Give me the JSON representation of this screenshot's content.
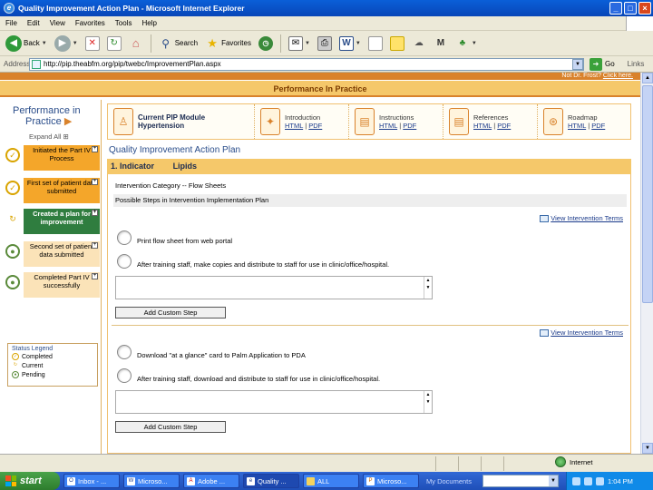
{
  "window": {
    "title": "Quality Improvement Action Plan - Microsoft Internet Explorer",
    "buttons": [
      "_",
      "□",
      "×"
    ]
  },
  "menu": [
    "File",
    "Edit",
    "View",
    "Favorites",
    "Tools",
    "Help"
  ],
  "toolbar": {
    "back_label": "Back",
    "search_label": "Search",
    "favorites_label": "Favorites"
  },
  "address": {
    "label": "Address",
    "url": "http://pip.theabfm.org/pip/twebc/ImprovementPlan.aspx",
    "go_label": "Go",
    "links_label": "Links"
  },
  "site": {
    "top_link_prefix": "Not Dr. Frost?",
    "top_link": "Click here.",
    "banner": "Performance In Practice",
    "logo_line1": "Performance in",
    "logo_line2": "Practice",
    "expand_all": "Expand All",
    "legend_title": "Status Legend",
    "legend": [
      "Completed",
      "Current",
      "Pending"
    ]
  },
  "steps": [
    {
      "label": "Initiated the Part IV Process",
      "status": "completed"
    },
    {
      "label": "First set of patient data submitted",
      "status": "completed"
    },
    {
      "label": "Created a plan for improvement",
      "status": "current"
    },
    {
      "label": "Second set of patient data submitted",
      "status": "pending"
    },
    {
      "label": "Completed Part IV successfully",
      "status": "pending"
    }
  ],
  "module": {
    "current_title_line1": "Current PIP Module",
    "current_title_line2": "Hypertension",
    "sections": [
      {
        "title": "Introduction",
        "html": "HTML",
        "pdf": "PDF"
      },
      {
        "title": "Instructions",
        "html": "HTML",
        "pdf": "PDF"
      },
      {
        "title": "References",
        "html": "HTML",
        "pdf": "PDF"
      },
      {
        "title": "Roadmap",
        "html": "HTML",
        "pdf": "PDF"
      }
    ]
  },
  "plan": {
    "title": "Quality Improvement Action Plan",
    "indicator_num": "1.",
    "indicator_label": "Indicator",
    "indicator_value": "Lipids",
    "intervention_category": "Intervention Category -- Flow Sheets",
    "possible_steps_header": "Possible Steps in Intervention Implementation Plan",
    "view_terms": "View Intervention Terms",
    "add_custom_step": "Add Custom Step",
    "group1_steps": [
      "Print flow sheet from web portal",
      "After training staff, make copies and distribute to staff for use in clinic/office/hospital."
    ],
    "group2_steps": [
      "Download \"at a glance\" card to Palm Application to PDA",
      "After training staff, download and distribute to staff for use in clinic/office/hospital."
    ]
  },
  "status": {
    "zone": "Internet"
  },
  "taskbar": {
    "start": "start",
    "tasks": [
      "Inbox - ...",
      "Microso...",
      "Adobe ...",
      "Quality ...",
      "ALL",
      "Microso..."
    ],
    "my_documents": "My Documents",
    "clock": "1:04 PM"
  }
}
